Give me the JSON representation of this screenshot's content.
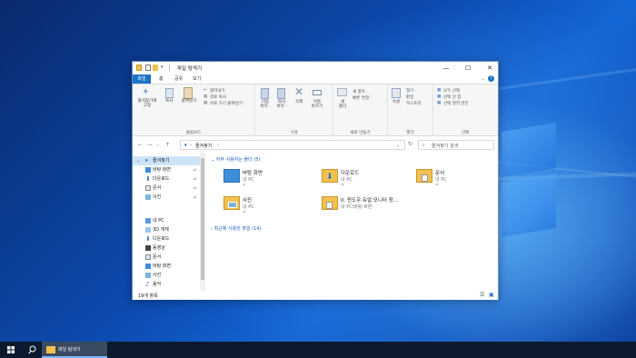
{
  "window": {
    "title": "파일 탐색기",
    "controls": {
      "minimize": "—",
      "maximize": "☐",
      "close": "✕"
    }
  },
  "ribbon_tabs": [
    "파일",
    "홈",
    "공유",
    "보기"
  ],
  "ribbon": {
    "clipboard": {
      "label": "클립보드",
      "pin_label": "즐겨찾기에\n고정",
      "copy_label": "복사",
      "paste_label": "붙여넣기",
      "cut": "잘라내기",
      "copy_path": "경로 복사",
      "paste_shortcut": "바로 가기 붙여넣기"
    },
    "organize": {
      "label": "구성",
      "move_to": "이동\n위치 ·",
      "copy_to": "복사\n위치 ·",
      "delete": "삭제",
      "rename": "이름\n바꾸기"
    },
    "new": {
      "label": "새로 만들기",
      "new_folder": "새\n폴더",
      "new_item": "새 항목 ·",
      "easy_access": "빠른 연결 ·"
    },
    "open": {
      "label": "열기",
      "properties": "속성",
      "open": "열기 ·",
      "edit": "편집",
      "history": "히스토리"
    },
    "select": {
      "label": "선택",
      "select_all": "모두 선택",
      "select_none": "선택 안 함",
      "invert": "선택 영역 반전"
    }
  },
  "address": {
    "path": "즐겨찾기",
    "search_placeholder": "즐겨찾기 검색"
  },
  "nav": {
    "quick_access": "즐겨찾기",
    "quick_items": [
      {
        "label": "바탕 화면",
        "pinned": true
      },
      {
        "label": "다운로드",
        "pinned": true
      },
      {
        "label": "문서",
        "pinned": true
      },
      {
        "label": "사진",
        "pinned": true
      }
    ],
    "this_pc": "내 PC",
    "pc_items": [
      "3D 개체",
      "다운로드",
      "동영상",
      "문서",
      "바탕 화면",
      "사진",
      "음악"
    ]
  },
  "content": {
    "frequent_header": "자주 사용하는 폴더 (5)",
    "recent_header": "최근에 사용한 파일 (14)",
    "folders": [
      {
        "name": "바탕 화면",
        "location": "내 PC",
        "pin": "⊿"
      },
      {
        "name": "다운로드",
        "location": "내 PC",
        "pin": "⊿"
      },
      {
        "name": "문서",
        "location": "내 PC",
        "pin": "⊿"
      },
      {
        "name": "사진",
        "location": "내 PC",
        "pin": "⊿"
      },
      {
        "name": "0. 윈도우 듀얼 모니터 창...",
        "location": "내 PC\\바탕 화면",
        "pin": ""
      }
    ]
  },
  "status": {
    "count": "19개 항목"
  },
  "taskbar": {
    "app_label": "파일 탐색기"
  },
  "colors": {
    "accent": "#1a73c7",
    "folder": "#f2c14e",
    "taskbar": "#0b1a2e"
  }
}
